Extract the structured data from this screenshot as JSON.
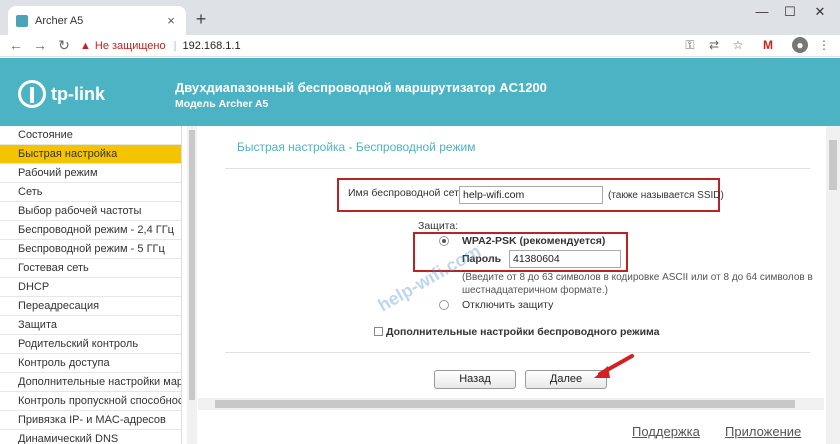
{
  "browser": {
    "tab_title": "Archer A5",
    "tab_close": "×",
    "new_tab": "+",
    "not_secure": "Не защищено",
    "separator": "|",
    "url": "192.168.1.1"
  },
  "header": {
    "logo_text": "tp-link",
    "title": "Двухдиапазонный беспроводной маршрутизатор AC1200",
    "model": "Модель Archer A5"
  },
  "sidebar": {
    "items": [
      {
        "label": "Состояние"
      },
      {
        "label": "Быстрая настройка"
      },
      {
        "label": "Рабочий режим"
      },
      {
        "label": "Сеть"
      },
      {
        "label": "Выбор рабочей частоты"
      },
      {
        "label": "Беспроводной режим - 2,4 ГГц"
      },
      {
        "label": "Беспроводной режим - 5 ГГц"
      },
      {
        "label": "Гостевая сеть"
      },
      {
        "label": "DHCP"
      },
      {
        "label": "Переадресация"
      },
      {
        "label": "Защита"
      },
      {
        "label": "Родительский контроль"
      },
      {
        "label": "Контроль доступа"
      },
      {
        "label": "Дополнительные настройки марш"
      },
      {
        "label": "Контроль пропускной способност"
      },
      {
        "label": "Привязка IP- и MAC-адресов"
      },
      {
        "label": "Динамический DNS"
      }
    ],
    "active_index": 1
  },
  "main": {
    "page_title": "Быстрая настройка - Беспроводной режим",
    "ssid_label": "Имя беспроводной сети:",
    "ssid_value": "help-wifi.com",
    "ssid_note": "(также называется SSID)",
    "security_label": "Защита:",
    "wpa_label": "WPA2-PSK (рекомендуется)",
    "password_label": "Пароль",
    "password_value": "41380604",
    "password_hint_1": "(Введите от 8 до 63 символов в кодировке ASCII или от 8 до 64 символов в",
    "password_hint_2": "шестнадцатеричном формате.)",
    "disable_label": "Отключить защиту",
    "advanced_label": "Дополнительные настройки беспроводного режима",
    "back_button": "Назад",
    "next_button": "Далее",
    "watermark": "help-wifi.com"
  },
  "footer": {
    "support": "Поддержка",
    "app": "Приложение"
  },
  "colors": {
    "banner": "#4cb3c4",
    "active_nav": "#f5c400",
    "highlight_box": "#bb2222",
    "arrow": "#d42020"
  }
}
